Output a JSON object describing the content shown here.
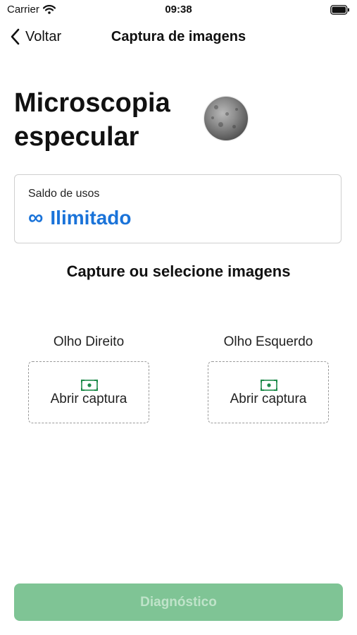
{
  "status_bar": {
    "carrier": "Carrier",
    "time": "09:38"
  },
  "nav": {
    "back_label": "Voltar",
    "title": "Captura de imagens"
  },
  "page": {
    "title": "Microscopia especular"
  },
  "usage": {
    "label": "Saldo de usos",
    "symbol": "∞",
    "value": "Ilimitado",
    "accent_color": "#1a73d9"
  },
  "capture_section": {
    "title": "Capture ou selecione imagens",
    "eyes": [
      {
        "label": "Olho Direito",
        "action_label": "Abrir captura"
      },
      {
        "label": "Olho Esquerdo",
        "action_label": "Abrir captura"
      }
    ],
    "icon_color": "#1e8a4a"
  },
  "footer": {
    "diagnose_label": "Diagnóstico",
    "button_color": "#7fc495"
  },
  "icons": [
    "wifi-icon",
    "battery-icon",
    "chevron-left-icon",
    "camera-frame-icon"
  ]
}
